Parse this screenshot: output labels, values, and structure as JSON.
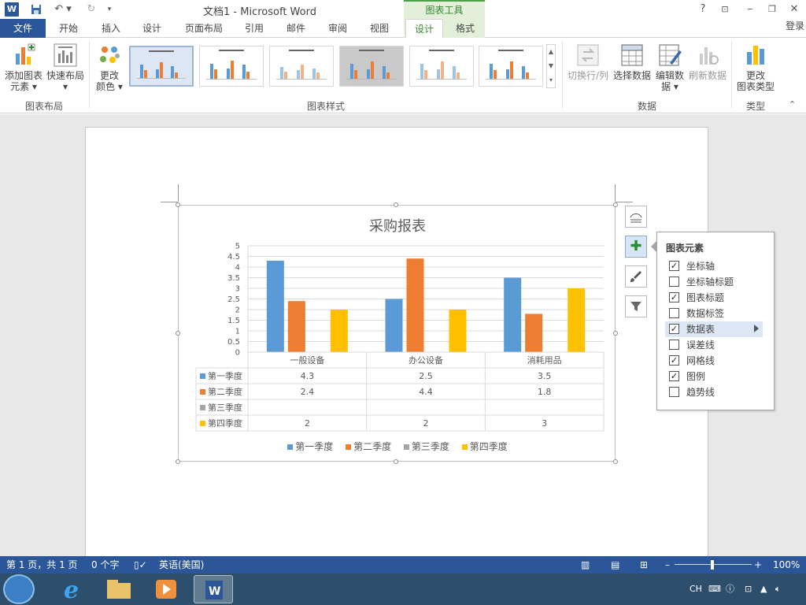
{
  "app": {
    "doc_title": "文档1 - Microsoft Word",
    "context_title": "图表工具",
    "help": "?",
    "login": "登录"
  },
  "tabs": [
    "文件",
    "开始",
    "插入",
    "设计",
    "页面布局",
    "引用",
    "邮件",
    "审阅",
    "视图",
    "设计",
    "格式"
  ],
  "ribbon": {
    "add_element": "添加图表\n元素",
    "add_element_1": "添加图表",
    "add_element_2": "元素 ▾",
    "quick_layout_1": "快速布局",
    "quick_layout_2": "▾",
    "change_color_1": "更改",
    "change_color_2": "颜色 ▾",
    "group_layout": "图表布局",
    "group_styles": "图表样式",
    "switch_rowcol": "切换行/列",
    "select_data": "选择数据",
    "edit_data_1": "编辑数",
    "edit_data_2": "据 ▾",
    "refresh_data": "刷新数据",
    "group_data": "数据",
    "change_type_1": "更改",
    "change_type_2": "图表类型",
    "group_type": "类型"
  },
  "chart_data": {
    "type": "bar",
    "title": "采购报表",
    "categories": [
      "一般设备",
      "办公设备",
      "消耗用品"
    ],
    "series": [
      {
        "name": "第一季度",
        "values": [
          4.3,
          2.5,
          3.5
        ],
        "color": "#5b9bd5"
      },
      {
        "name": "第二季度",
        "values": [
          2.4,
          4.4,
          1.8
        ],
        "color": "#ed7d31"
      },
      {
        "name": "第三季度",
        "values": [
          null,
          null,
          null
        ],
        "color": "#a5a5a5"
      },
      {
        "name": "第四季度",
        "values": [
          2,
          2,
          3
        ],
        "color": "#ffc000"
      }
    ],
    "ylim": [
      0,
      5
    ],
    "yticks": [
      "0",
      "0.5",
      "1",
      "1.5",
      "2",
      "2.5",
      "3",
      "3.5",
      "4",
      "4.5",
      "5"
    ],
    "data_table": true,
    "gridlines": true,
    "legend": "bottom"
  },
  "flyout": {
    "title": "图表元素",
    "items": [
      {
        "label": "坐标轴",
        "checked": true
      },
      {
        "label": "坐标轴标题",
        "checked": false
      },
      {
        "label": "图表标题",
        "checked": true
      },
      {
        "label": "数据标签",
        "checked": false
      },
      {
        "label": "数据表",
        "checked": true
      },
      {
        "label": "误差线",
        "checked": false
      },
      {
        "label": "网格线",
        "checked": true
      },
      {
        "label": "图例",
        "checked": true
      },
      {
        "label": "趋势线",
        "checked": false
      }
    ]
  },
  "status": {
    "page": "第 1 页，共 1 页",
    "words": "0 个字",
    "lang": "英语(美国)",
    "zoom": "100%"
  },
  "taskbar": {
    "ime": "CH"
  },
  "colors": {
    "word_blue": "#2b579a",
    "context_green": "#2f8a30"
  }
}
